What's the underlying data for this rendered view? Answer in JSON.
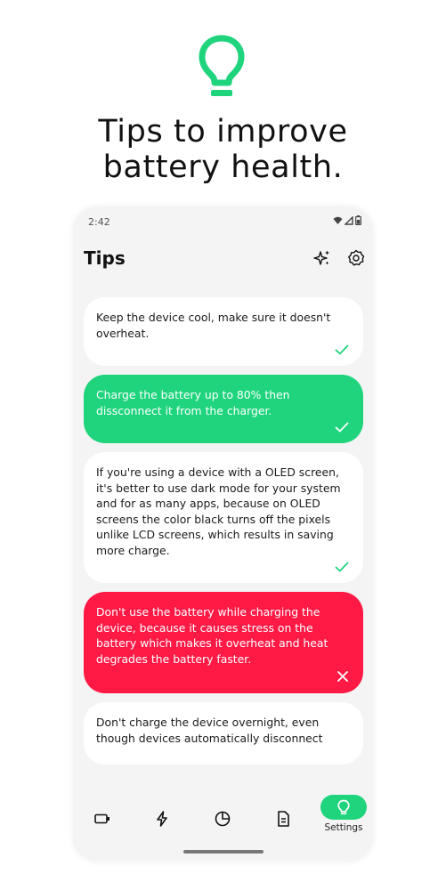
{
  "hero": {
    "icon": "lightbulb-icon",
    "accent": "#1fd47d",
    "headline_line1": "Tips to improve",
    "headline_line2": "battery health."
  },
  "status_bar": {
    "time": "2:42",
    "icons": [
      "wifi-icon",
      "signal-icon",
      "battery-icon"
    ]
  },
  "app_bar": {
    "title": "Tips",
    "actions": [
      "sparkle-icon",
      "settings-gear-icon"
    ]
  },
  "tips": [
    {
      "text": "Keep the device cool, make sure it doesn't overheat.",
      "style": "white",
      "status_icon": "check-icon",
      "icon_color": "#1fd47d"
    },
    {
      "text": "Charge the battery up to 80% then dissconnect it from the charger.",
      "style": "green",
      "status_icon": "check-icon",
      "icon_color": "#ffffff"
    },
    {
      "text": "If you're using a device with a  OLED screen, it's better to use dark mode for your system and for as many apps, because on OLED screens the color black turns off the pixels unlike LCD screens, which results in saving more charge.",
      "style": "white",
      "status_icon": "check-icon",
      "icon_color": "#1fd47d"
    },
    {
      "text": "Don't use the battery while charging the device, because it causes stress on the battery which makes it overheat and heat degrades the battery faster.",
      "style": "red",
      "status_icon": "close-icon",
      "icon_color": "#ffffff"
    },
    {
      "text": "Don't charge the device overnight, even though devices automatically disconnect",
      "style": "white"
    }
  ],
  "bottom_nav": {
    "items": [
      "battery-info-icon",
      "charging-bolt-icon",
      "usage-pie-icon",
      "document-icon",
      "tips-lightbulb-icon"
    ],
    "active_label": "Settings",
    "active_color": "#1fd47d"
  },
  "colors": {
    "green": "#1fd47d",
    "red": "#ff1a46",
    "phone_bg": "#f4f4f4",
    "card_bg": "#ffffff"
  }
}
